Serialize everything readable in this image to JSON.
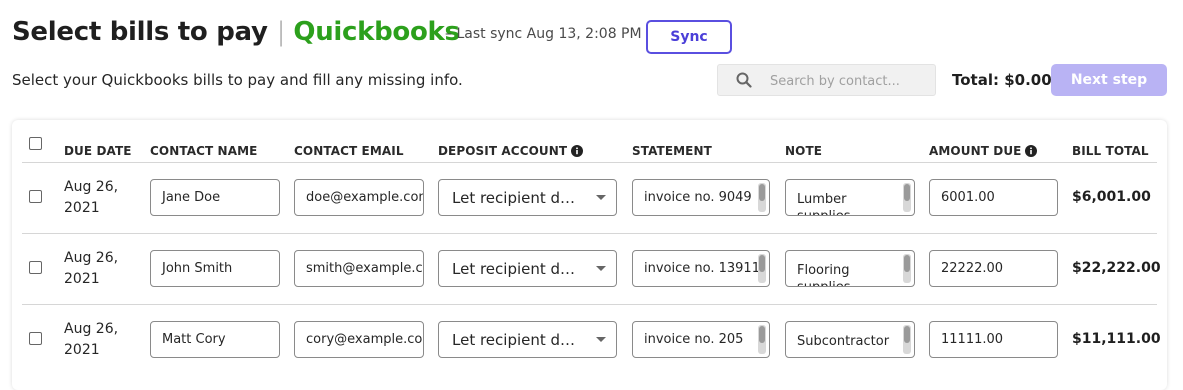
{
  "header": {
    "title": "Select bills to pay",
    "separator": "|",
    "brand": "Quickbooks",
    "last_sync": "– Last sync Aug 13, 2:08 PM",
    "sync_label": "Sync",
    "subtitle": "Select your Quickbooks bills to pay and fill any missing info."
  },
  "toolbar": {
    "search_placeholder": "Search by contact...",
    "total": "Total: $0.00",
    "next_label": "Next step"
  },
  "table": {
    "headers": {
      "due_date": "DUE DATE",
      "contact_name": "CONTACT NAME",
      "contact_email": "CONTACT EMAIL",
      "deposit_account": "DEPOSIT ACCOUNT",
      "statement": "STATEMENT",
      "note": "NOTE",
      "amount_due": "AMOUNT DUE",
      "bill_total": "BILL TOTAL"
    },
    "rows": [
      {
        "due_line1": "Aug 26,",
        "due_line2": "2021",
        "name": "Jane Doe",
        "email": "doe@example.com",
        "deposit": "Let recipient decide",
        "statement": "invoice no. 9049",
        "note": "Lumber supplies",
        "amount": "6001.00",
        "bill_total": "$6,001.00"
      },
      {
        "due_line1": "Aug 26,",
        "due_line2": "2021",
        "name": "John Smith",
        "email": "smith@example.com",
        "deposit": "Let recipient decide",
        "statement": "invoice no. 13911",
        "note": "Flooring supplies",
        "amount": "22222.00",
        "bill_total": "$22,222.00"
      },
      {
        "due_line1": "Aug 26,",
        "due_line2": "2021",
        "name": "Matt Cory",
        "email": "cory@example.com",
        "deposit": "Let recipient decide",
        "statement": "invoice no. 205",
        "note": "Subcontractor",
        "amount": "11111.00",
        "bill_total": "$11,111.00"
      }
    ]
  },
  "colors": {
    "accent": "#5a4fe0",
    "brand": "#2ca01c",
    "next_disabled": "#b9b3f4"
  }
}
